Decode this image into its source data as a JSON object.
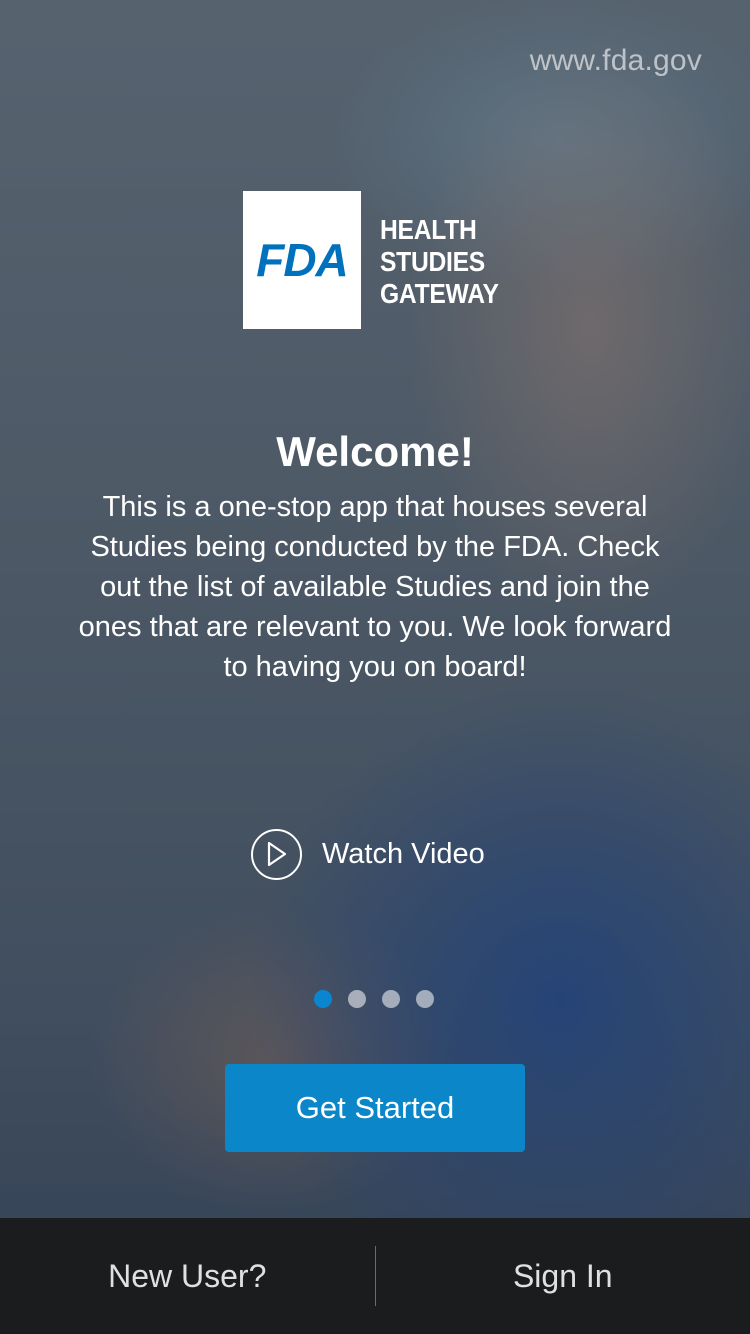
{
  "header": {
    "url_text": "www.fda.gov"
  },
  "logo": {
    "mark": "FDA",
    "lines": [
      "HEALTH",
      "STUDIES",
      "GATEWAY"
    ]
  },
  "welcome": {
    "title": "Welcome!",
    "body": "This is a one-stop app that houses several Studies being conducted  by the FDA.  Check out the list of available Studies and join the ones that are relevant to you. We look forward to having you on board!"
  },
  "video": {
    "label": "Watch Video",
    "icon": "play-icon"
  },
  "pager": {
    "count": 4,
    "active_index": 0
  },
  "actions": {
    "get_started": "Get Started"
  },
  "bottom_bar": {
    "new_user": "New User?",
    "sign_in": "Sign In"
  },
  "colors": {
    "brand_blue": "#0071bc",
    "button_blue": "#0a86c9",
    "dot_active": "#0a86d0"
  }
}
